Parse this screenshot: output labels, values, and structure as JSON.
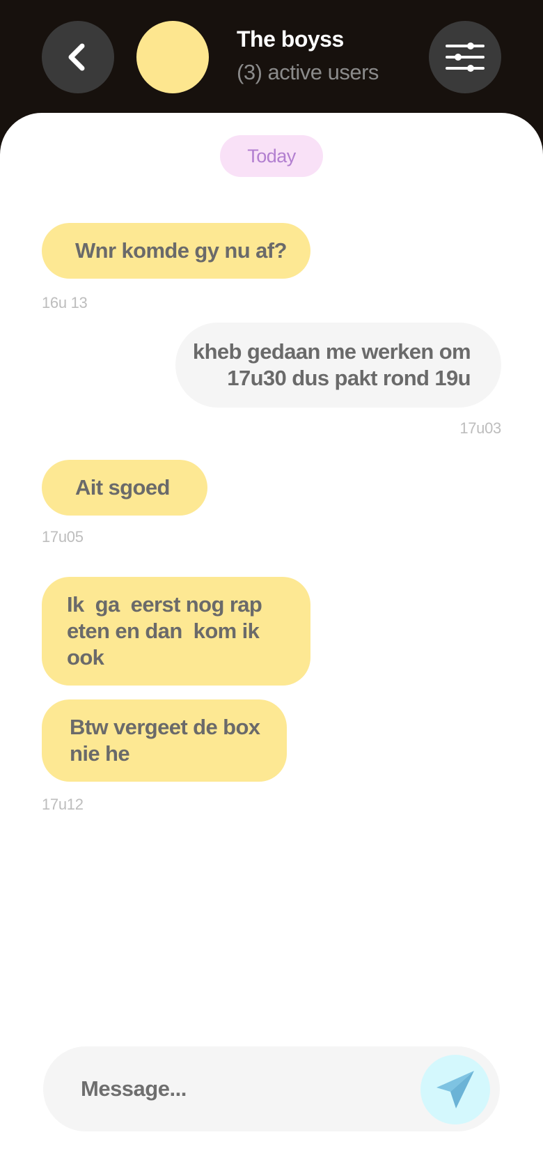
{
  "header": {
    "back_icon": "chevron-left-icon",
    "group_name": "The boyss",
    "active_users": "(3) active users",
    "settings_icon": "sliders-icon",
    "avatar_color": "#fde68f"
  },
  "chat": {
    "date_label": "Today",
    "messages": [
      {
        "direction": "incoming",
        "text": "Wnr komde gy nu af?",
        "time": "16u 13"
      },
      {
        "direction": "outgoing",
        "text": "kheb gedaan me werken om 17u30 dus pakt rond 19u",
        "time": "17u03"
      },
      {
        "direction": "incoming",
        "text": "Ait sgoed",
        "time": "17u05"
      },
      {
        "direction": "incoming",
        "text": "Ik  ga  eerst nog rap eten en dan  kom ik ook",
        "time": ""
      },
      {
        "direction": "incoming",
        "text": "Btw vergeet de box nie he",
        "time": "17u12"
      }
    ]
  },
  "composer": {
    "placeholder": "Message...",
    "value": "",
    "send_icon": "paper-plane-icon"
  },
  "colors": {
    "header_bg": "#17110d",
    "incoming_bubble": "#fde893",
    "outgoing_bubble": "#f5f5f5",
    "date_pill_bg": "#f9e1f7",
    "date_pill_text": "#b27fd0",
    "send_button_bg": "#d4f8fd",
    "send_icon": "#7ec3e2"
  }
}
